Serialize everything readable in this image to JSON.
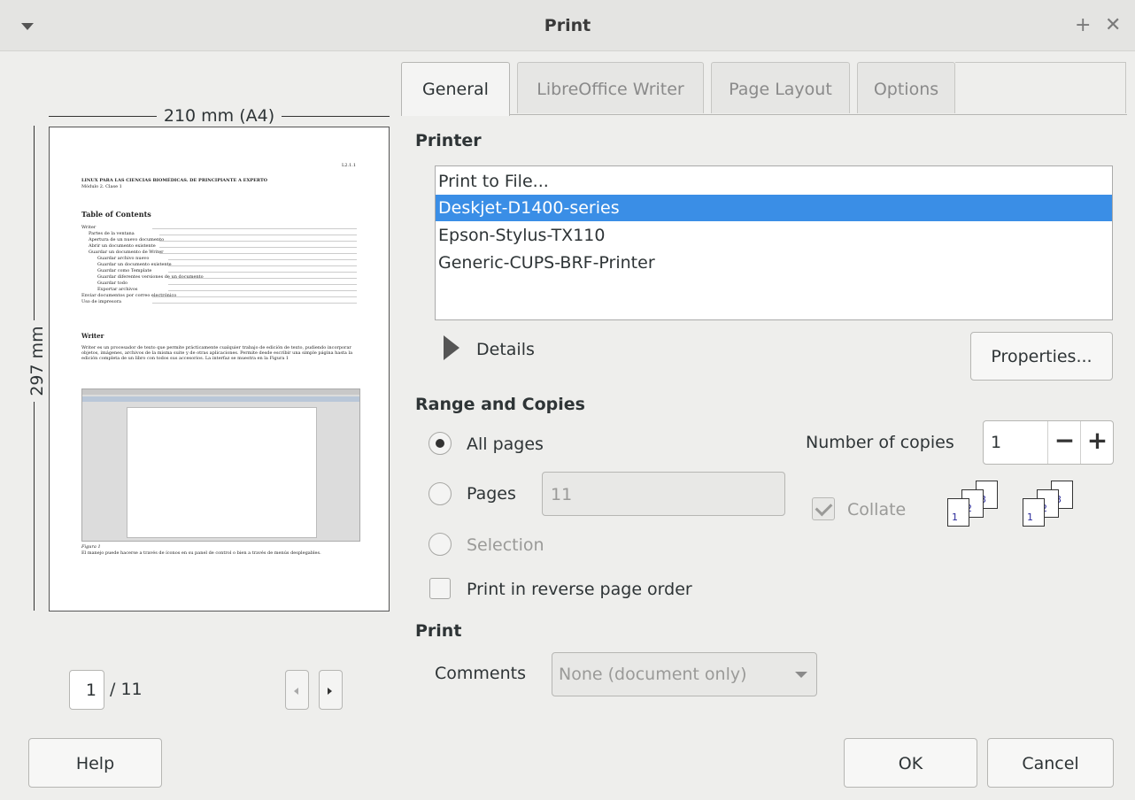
{
  "window": {
    "title": "Print",
    "menu_icon": "chevron-down-icon",
    "maximize_glyph": "+",
    "close_glyph": "✕"
  },
  "preview": {
    "width_label": "210 mm (A4)",
    "height_label": "297 mm",
    "doc": {
      "header_right": "L2.1.1",
      "heading1": "LINUX PARA LAS CIENCIAS BIOMÉDICAS. DE PRINCIPIANTE A EXPERTO",
      "sub1": "Módulo 2. Clase 1",
      "toc_title": "Table of Contents",
      "toc": [
        "Writer",
        "Partes de la ventana",
        "Apertura de un nuevo documento",
        "Abrir un documento existente",
        "Guardar un documento de Writer",
        "Guardar archivo nuevo",
        "Guardar un documento existente",
        "Guardar como Template",
        "Guardar diferentes versiones de un documento",
        "Guardar todo",
        "Exportar archivos",
        "Enviar documentos por correo electrónico",
        "Uso de impresora"
      ],
      "section": "Writer",
      "para": "Writer es un procesador de texto que permite prácticamente cualquier trabajo de edición de texto, pudiendo incorporar objetos, imágenes, archivos de la misma suite y de otras aplicaciones. Permite desde escribir una simple página hasta la edición completa de un libro con todos sus accesorios. La interfaz se muestra en la Figura 1",
      "figure_caption": "Figura 1",
      "para2": "El manejo puede hacerse a través de íconos en su panel de control o bien a través de menús desplegables."
    },
    "current_page": "1",
    "total_pages": "/ 11"
  },
  "tabs": [
    "General",
    "LibreOffice Writer",
    "Page Layout",
    "Options"
  ],
  "printer": {
    "section_title": "Printer",
    "items": [
      "Print to File...",
      "Deskjet-D1400-series",
      "Epson-Stylus-TX110",
      "Generic-CUPS-BRF-Printer"
    ],
    "selected_index": 1,
    "details_label": "Details",
    "properties_button": "Properties..."
  },
  "range": {
    "section_title": "Range and Copies",
    "all_pages": "All pages",
    "pages": "Pages",
    "pages_value": "11",
    "selection": "Selection",
    "reverse": "Print in reverse page order",
    "copies_label": "Number of copies",
    "copies_value": "1",
    "minus": "−",
    "plus": "+",
    "collate": "Collate"
  },
  "print_section": {
    "title": "Print",
    "comments_label": "Comments",
    "comments_value": "None (document only)"
  },
  "buttons": {
    "help": "Help",
    "ok": "OK",
    "cancel": "Cancel"
  }
}
